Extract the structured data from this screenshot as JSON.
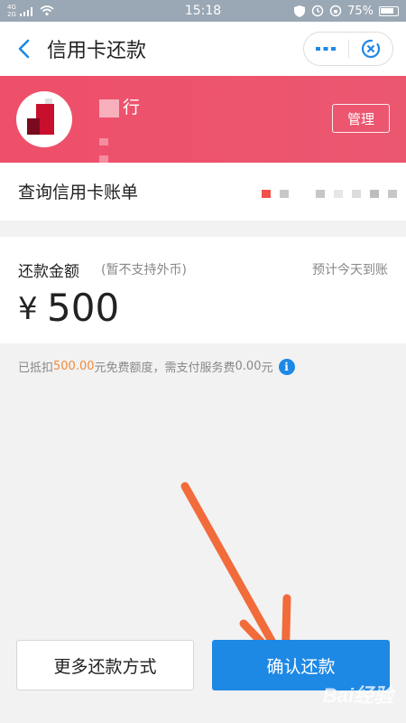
{
  "status_bar": {
    "network_top": "4G",
    "network_bottom": "2G",
    "time": "15:18",
    "battery": "75%"
  },
  "nav": {
    "title": "信用卡还款"
  },
  "card": {
    "bank_name_visible": "行",
    "manage_label": "管理"
  },
  "bill": {
    "label": "查询信用卡账单"
  },
  "amount": {
    "title": "还款金额",
    "note": "(暂不支持外币)",
    "arrival": "预计今天到账",
    "currency": "¥",
    "value": "500"
  },
  "fee": {
    "prefix": "已抵扣",
    "amount": "500.00",
    "middle": "元免费额度，需支付服务费",
    "service_fee": "0.00",
    "suffix": "元"
  },
  "buttons": {
    "more_label": "更多还款方式",
    "confirm_label": "确认还款"
  },
  "watermark": "Bai经验",
  "colors": {
    "brand_blue": "#1e88e5",
    "banner_red": "#ec5770",
    "highlight_orange": "#f08a3c",
    "annotation_arrow": "#f26b3a"
  }
}
